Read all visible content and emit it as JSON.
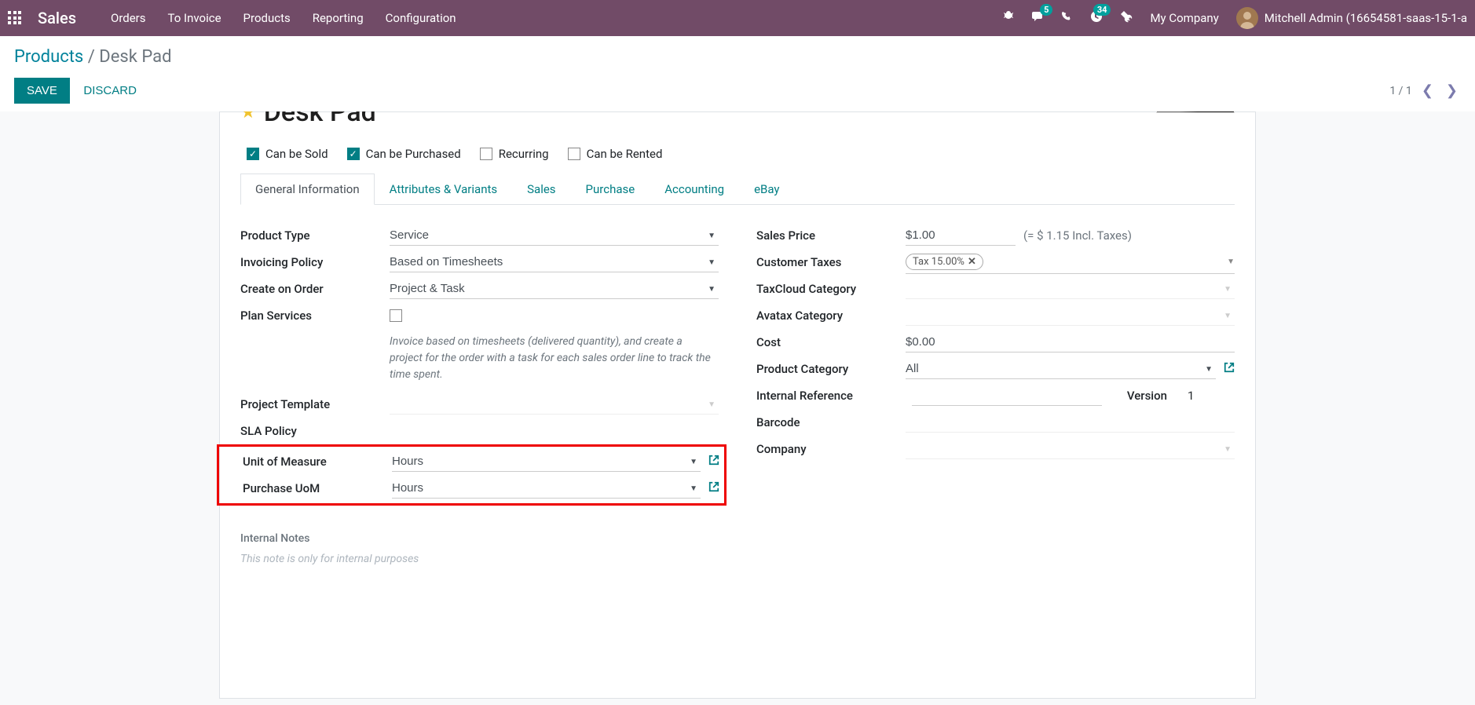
{
  "topbar": {
    "brand": "Sales",
    "menu": [
      "Orders",
      "To Invoice",
      "Products",
      "Reporting",
      "Configuration"
    ],
    "msg_badge": "5",
    "activity_badge": "34",
    "company": "My Company",
    "user": "Mitchell Admin (16654581-saas-15-1-a"
  },
  "breadcrumb": {
    "parent": "Products",
    "current": "Desk Pad"
  },
  "actions": {
    "save": "SAVE",
    "discard": "DISCARD"
  },
  "pager": {
    "text": "1 / 1"
  },
  "title": "Desk Pad",
  "checkboxes": {
    "sold": {
      "label": "Can be Sold",
      "checked": true
    },
    "purchased": {
      "label": "Can be Purchased",
      "checked": true
    },
    "recurring": {
      "label": "Recurring",
      "checked": false
    },
    "rented": {
      "label": "Can be Rented",
      "checked": false
    }
  },
  "tabs": [
    "General Information",
    "Attributes & Variants",
    "Sales",
    "Purchase",
    "Accounting",
    "eBay"
  ],
  "left": {
    "product_type": {
      "label": "Product Type",
      "value": "Service"
    },
    "invoicing_policy": {
      "label": "Invoicing Policy",
      "value": "Based on Timesheets"
    },
    "create_on_order": {
      "label": "Create on Order",
      "value": "Project & Task"
    },
    "plan_services": {
      "label": "Plan Services"
    },
    "help": "Invoice based on timesheets (delivered quantity), and create a project for the order with a task for each sales order line to track the time spent.",
    "project_template": {
      "label": "Project Template",
      "value": ""
    },
    "sla_policy": {
      "label": "SLA Policy",
      "value": ""
    },
    "uom": {
      "label": "Unit of Measure",
      "value": "Hours"
    },
    "purchase_uom": {
      "label": "Purchase UoM",
      "value": "Hours"
    }
  },
  "right": {
    "sales_price": {
      "label": "Sales Price",
      "value": "$1.00",
      "note": "(= $ 1.15 Incl. Taxes)"
    },
    "customer_taxes": {
      "label": "Customer Taxes",
      "tag": "Tax 15.00%"
    },
    "taxcloud": {
      "label": "TaxCloud Category",
      "value": ""
    },
    "avatax": {
      "label": "Avatax Category",
      "value": ""
    },
    "cost": {
      "label": "Cost",
      "value": "$0.00"
    },
    "product_category": {
      "label": "Product Category",
      "value": "All"
    },
    "internal_ref": {
      "label": "Internal Reference",
      "value": "",
      "version_label": "Version",
      "version_value": "1"
    },
    "barcode": {
      "label": "Barcode",
      "value": ""
    },
    "company": {
      "label": "Company",
      "value": ""
    }
  },
  "notes": {
    "heading": "Internal Notes",
    "placeholder": "This note is only for internal purposes"
  }
}
